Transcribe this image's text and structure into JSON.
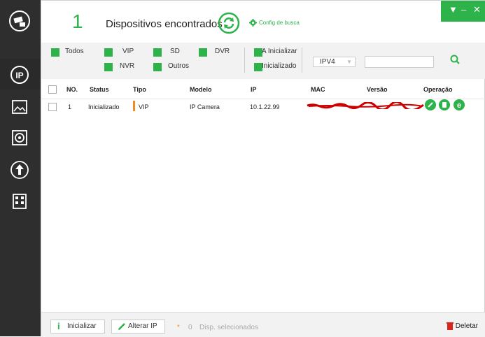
{
  "header": {
    "count": "1",
    "title": "Dispositivos encontrados",
    "config_label": "Config de busca",
    "window_controls": [
      "▼",
      "–",
      "✕"
    ]
  },
  "filters": {
    "todos": "Todos",
    "vip": "VIP",
    "sd": "SD",
    "dvr": "DVR",
    "nvr": "NVR",
    "outros": "Outros",
    "a_inicializar": "A Inicializar",
    "inicializado": "Inicializado",
    "ip_version": "IPV4",
    "search_value": ""
  },
  "table": {
    "headers": [
      "NO.",
      "Status",
      "Tipo",
      "Modelo",
      "IP",
      "MAC",
      "Versão",
      "Operação"
    ],
    "rows": [
      {
        "no": "1",
        "status": "Inicializado",
        "tipo": "VIP",
        "modelo": "IP Camera",
        "ip": "10.1.22.99"
      }
    ]
  },
  "footer": {
    "initialize": "Inicializar",
    "change_ip": "Alterar IP",
    "selected_count": "0",
    "selected_label": "Disp. selecionados",
    "delete": "Deletar"
  },
  "colors": {
    "accent": "#2db34a",
    "sidebar": "#2e2e2e",
    "tipo_marker": "#f08c28",
    "redaction": "#cc0000",
    "delete": "#d9261c"
  },
  "icons": [
    "camera-tool-icon",
    "ip-icon",
    "image-edit-icon",
    "disk-config-icon",
    "upgrade-icon",
    "building-icon",
    "refresh-icon",
    "gear-icon",
    "search-icon",
    "edit-icon",
    "web-icon",
    "browser-icon",
    "info-icon",
    "pencil-icon",
    "trash-icon"
  ]
}
